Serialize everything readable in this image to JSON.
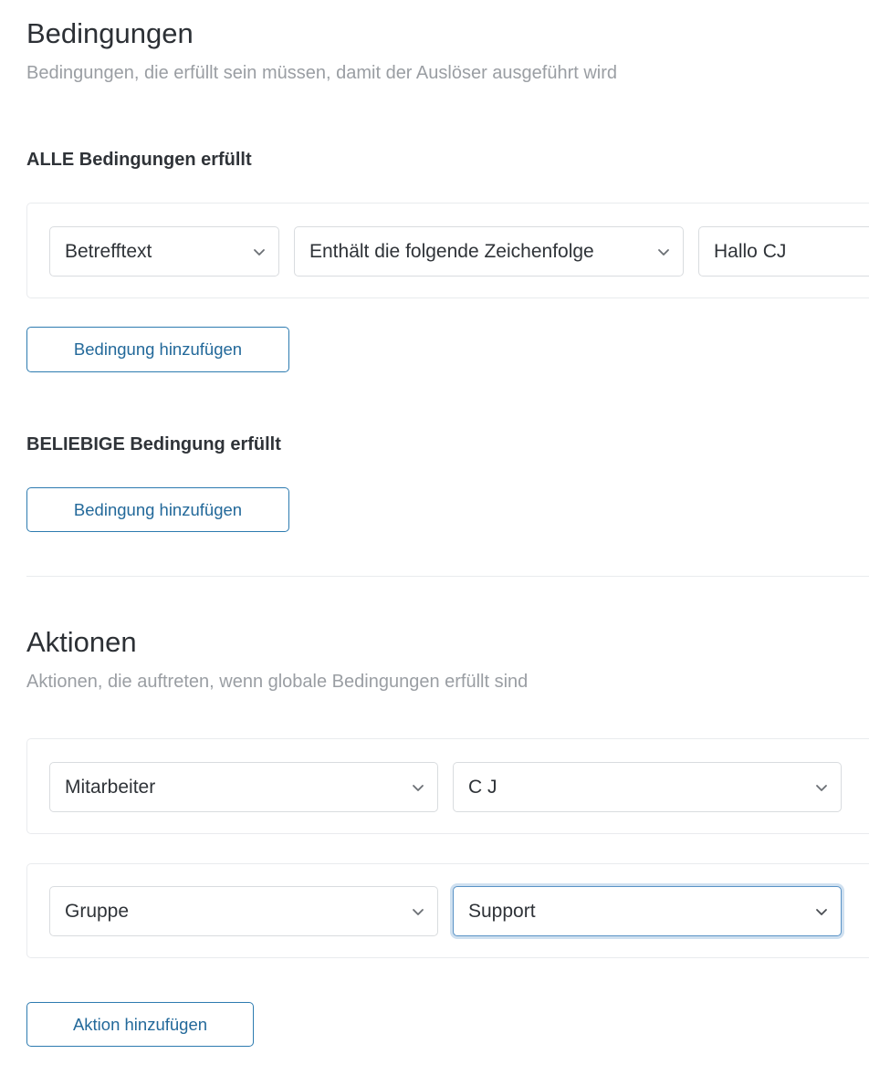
{
  "conditions": {
    "title": "Bedingungen",
    "description": "Bedingungen, die erfüllt sein müssen, damit der Auslöser ausgeführt wird",
    "all": {
      "label": "ALLE Bedingungen erfüllt",
      "rows": [
        {
          "field": "Betrefftext",
          "operator": "Enthält die folgende Zeichenfolge",
          "value": "Hallo CJ"
        }
      ],
      "add_button": "Bedingung hinzufügen"
    },
    "any": {
      "label": "BELIEBIGE Bedingung erfüllt",
      "add_button": "Bedingung hinzufügen"
    }
  },
  "actions": {
    "title": "Aktionen",
    "description": "Aktionen, die auftreten, wenn globale Bedingungen erfüllt sind",
    "rows": [
      {
        "type": "Mitarbeiter",
        "value": "C J"
      },
      {
        "type": "Gruppe",
        "value": "Support"
      }
    ],
    "add_button": "Aktion hinzufügen"
  },
  "colors": {
    "accent": "#2d7bb0",
    "focus": "#5a93c6",
    "border": "#d9dcdf",
    "muted_text": "#9a9ea3"
  }
}
